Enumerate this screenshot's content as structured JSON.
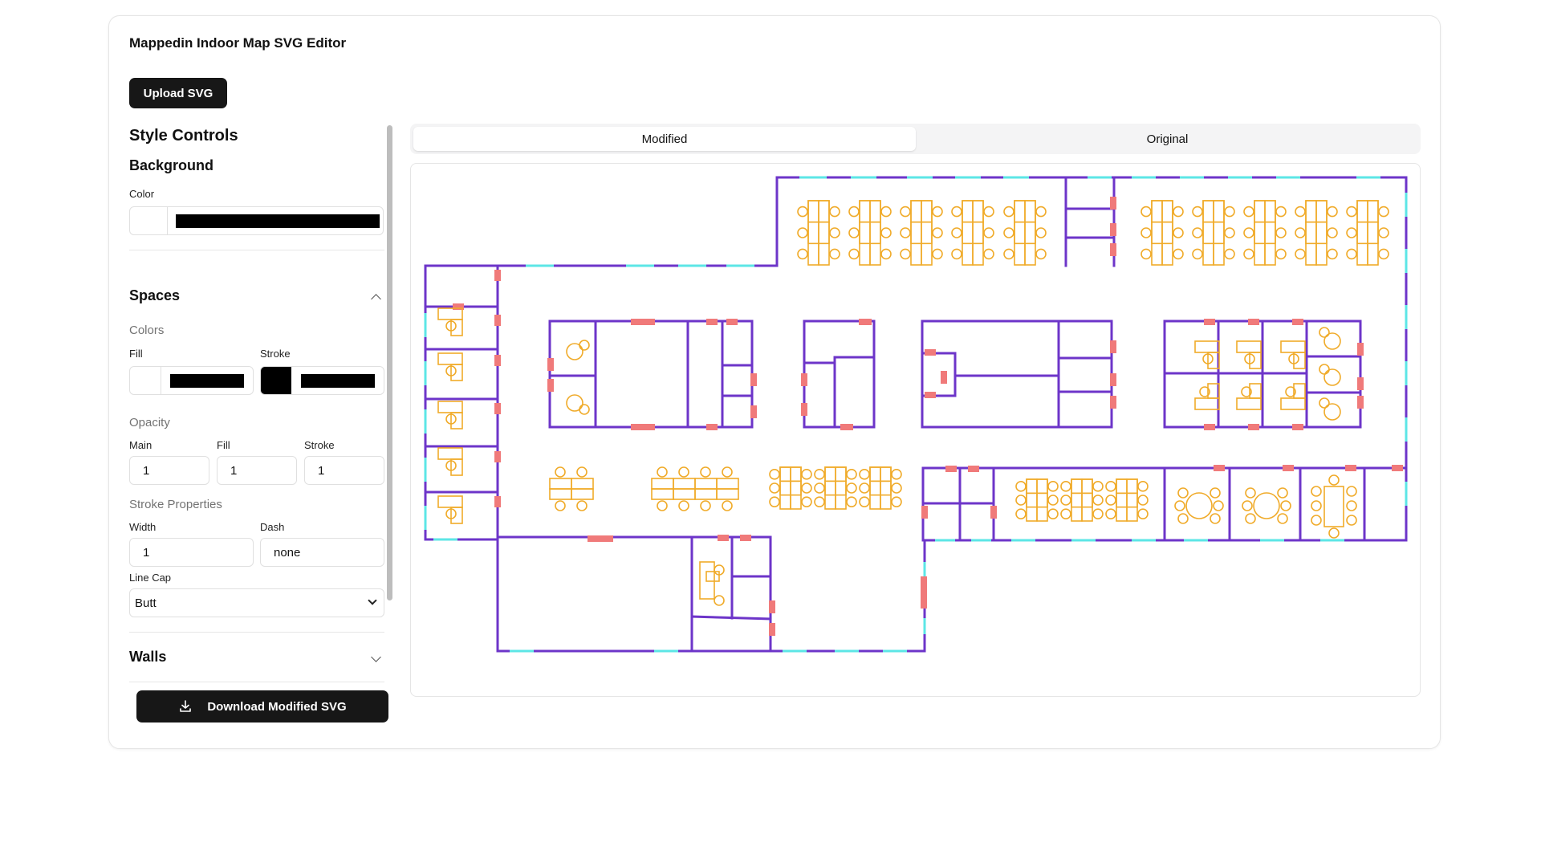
{
  "app": {
    "title": "Mappedin Indoor Map SVG Editor",
    "upload_label": "Upload SVG"
  },
  "controls": {
    "heading": "Style Controls",
    "background": {
      "heading": "Background",
      "color_label": "Color",
      "color_value": "#000000"
    },
    "spaces": {
      "heading": "Spaces",
      "colors_label": "Colors",
      "fill_label": "Fill",
      "stroke_label": "Stroke",
      "fill_color": "#000000",
      "stroke_color": "#000000",
      "opacity_label": "Opacity",
      "main_label": "Main",
      "fill_opacity_label": "Fill",
      "stroke_opacity_label": "Stroke",
      "main_value": "1",
      "fill_value": "1",
      "stroke_value": "1",
      "stroke_props_label": "Stroke Properties",
      "width_label": "Width",
      "dash_label": "Dash",
      "width_value": "1",
      "dash_value": "none",
      "linecap_label": "Line Cap",
      "linecap_value": "Butt"
    },
    "walls": {
      "heading": "Walls"
    },
    "download_label": "Download Modified SVG"
  },
  "tabs": [
    {
      "label": "Modified",
      "active": true
    },
    {
      "label": "Original",
      "active": false
    }
  ],
  "colors": {
    "wall": "#6d35c9",
    "door": "#f07a7a",
    "window": "#5ce6e6",
    "furniture": "#f0ab2a"
  },
  "icons": {
    "download": "download-icon",
    "chevron_up": "chevron-up-icon",
    "chevron_down": "chevron-down-icon",
    "select": "chevron-down-icon"
  }
}
